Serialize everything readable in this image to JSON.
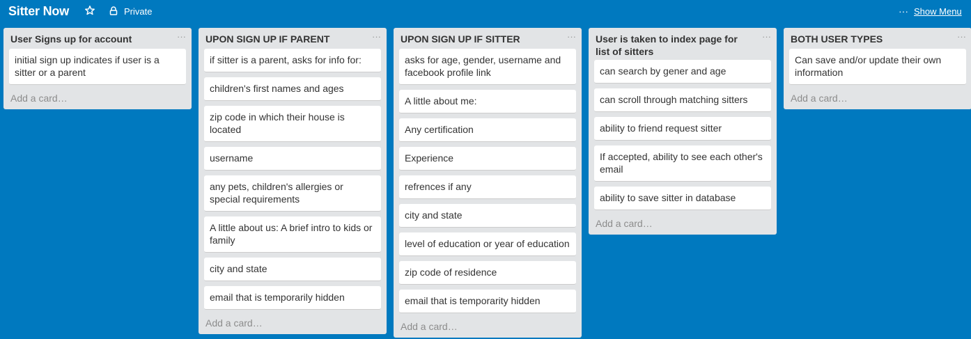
{
  "header": {
    "board_title": "Sitter Now",
    "privacy": "Private",
    "show_menu": "Show Menu",
    "icons": [
      "star-icon",
      "lock-icon",
      "dots-icon"
    ]
  },
  "add_card_label": "Add a card…",
  "lists": [
    {
      "title": "User Signs up for account",
      "cards": [
        "initial sign up indicates if user is a sitter or a parent"
      ],
      "add_card": "Add a card…"
    },
    {
      "title": "UPON SIGN UP IF PARENT",
      "cards": [
        "if sitter is a parent, asks for info for:",
        "children's first names and ages",
        "zip code in which their house is located",
        "username",
        "any pets, children's allergies or special requirements",
        "A little about us: A brief intro to kids or family",
        "city and state",
        "email that is temporarily hidden"
      ],
      "add_card": "Add a card…"
    },
    {
      "title": "UPON SIGN UP IF SITTER",
      "cards": [
        "asks for age, gender, username and facebook profile link",
        "A little about me:",
        "Any certification",
        "Experience",
        "refrences if any",
        "city and state",
        "level of education or year of education",
        "zip code of residence",
        "email that is temporarity hidden"
      ],
      "add_card": "Add a card…"
    },
    {
      "title": "User is taken to index page for list of sitters",
      "cards": [
        "can search by gener and age",
        "can scroll through matching sitters",
        "ability to friend request sitter",
        "If accepted, ability to see each other's email",
        "ability to save sitter in database"
      ],
      "add_card": "Add a card…"
    },
    {
      "title": "BOTH USER TYPES",
      "cards": [
        "Can save and/or update their own information"
      ],
      "add_card": "Add a card…"
    }
  ]
}
